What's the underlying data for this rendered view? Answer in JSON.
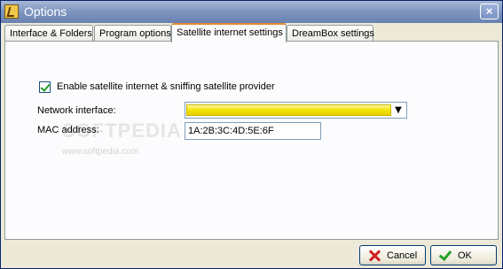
{
  "window": {
    "title": "Options"
  },
  "title_bar": {
    "close_glyph": "×"
  },
  "tabs": [
    {
      "label": "Interface & Folders",
      "active": false
    },
    {
      "label": "Program options",
      "active": false
    },
    {
      "label": "Satellite internet settings",
      "active": true
    },
    {
      "label": "DreamBox settings",
      "active": false
    }
  ],
  "satellite": {
    "enable_label": "Enable satellite internet & sniffing satellite provider",
    "enable_checked": true,
    "network_interface_label": "Network interface:",
    "network_interface_value": "",
    "dropdown_arrow": "▼",
    "mac_address_label": "MAC address:",
    "mac_address_value": "1A:2B:3C:4D:5E:6F"
  },
  "watermark": {
    "text": "SOFTPEDIA",
    "subtext": "www.softpedia.com"
  },
  "buttons": {
    "cancel": "Cancel",
    "ok": "OK"
  },
  "colors": {
    "active_tab_accent": "#e68b2c",
    "dropdown_fill": "#f3e200"
  }
}
